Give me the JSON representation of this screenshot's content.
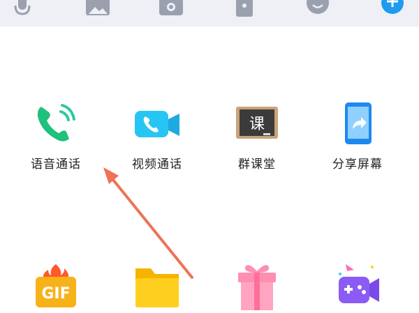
{
  "toolbar": {
    "icons": [
      "microphone-icon",
      "image-icon",
      "camera-icon",
      "red-packet-icon",
      "emoji-icon",
      "plus-icon"
    ],
    "accent": "#1e9bf0"
  },
  "panel": {
    "row1": [
      {
        "label": "语音通话",
        "icon": "phone-icon"
      },
      {
        "label": "视频通话",
        "icon": "video-call-icon"
      },
      {
        "label": "群课堂",
        "icon": "classroom-board-icon",
        "badge_text": "课"
      },
      {
        "label": "分享屏幕",
        "icon": "share-screen-icon"
      }
    ],
    "row2": [
      {
        "icon": "gif-icon",
        "badge_text": "GIF"
      },
      {
        "icon": "folder-icon"
      },
      {
        "icon": "gift-icon"
      },
      {
        "icon": "game-controller-icon"
      }
    ]
  },
  "annotation": {
    "arrow_color": "#ee7256"
  }
}
